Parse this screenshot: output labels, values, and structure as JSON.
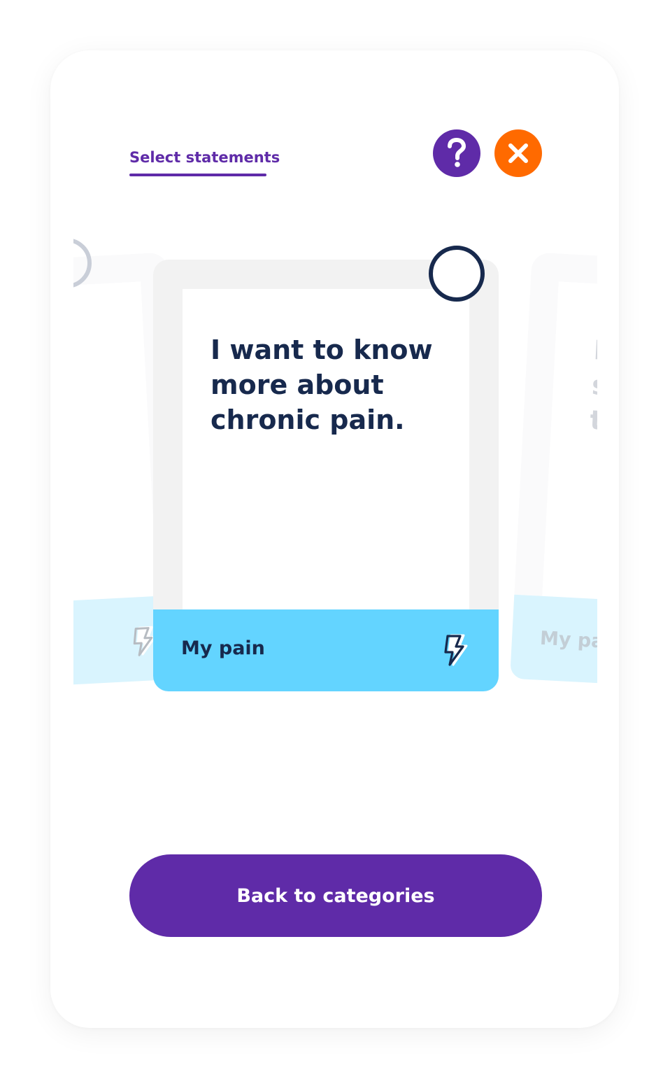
{
  "header": {
    "tab_label": "Select statements",
    "help_icon": "question-mark-icon",
    "close_icon": "close-x-icon"
  },
  "card": {
    "statement": "I want to know more about chronic pain.",
    "category": "My pain",
    "category_icon": "lightning-bolt-icon",
    "selected": false
  },
  "next_card": {
    "statement": "I\ns\nt",
    "category": "My pa"
  },
  "footer": {
    "back_label": "Back to categories"
  },
  "colors": {
    "purple": "#5f2ba8",
    "orange": "#ff6a00",
    "navy": "#17294d",
    "card_footer": "#63d4ff"
  }
}
